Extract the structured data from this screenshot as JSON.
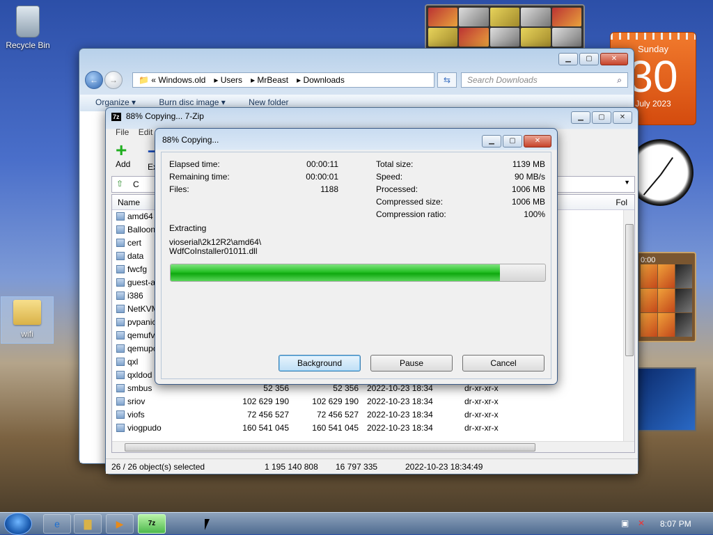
{
  "desktop": {
    "recycle_bin_label": "Recycle Bin",
    "wifi_folder_label": "wifi"
  },
  "gadgets": {
    "calendar_day": "Sunday",
    "calendar_date": "30",
    "calendar_month": "July 2023",
    "puzzle_timer": "0:00"
  },
  "explorer": {
    "breadcrumb_prefix": "«",
    "breadcrumbs": [
      "Windows.old",
      "Users",
      "MrBeast",
      "Downloads"
    ],
    "search_placeholder": "Search Downloads",
    "commands": [
      "Organize ▾",
      "Burn disc image ▾",
      "New folder"
    ]
  },
  "zip": {
    "title": "88% Copying... 7-Zip",
    "logo": "7z",
    "menu": [
      "File",
      "Edit"
    ],
    "toolbar": {
      "add": "Add",
      "extract": "Extr"
    },
    "path_fragment": "C",
    "column_name": "Name",
    "column_folders": "Fol",
    "files": [
      {
        "name": "amd64",
        "size": "",
        "packed": "",
        "modified": "",
        "attr": ""
      },
      {
        "name": "Balloon",
        "size": "",
        "packed": "",
        "modified": "",
        "attr": ""
      },
      {
        "name": "cert",
        "size": "",
        "packed": "",
        "modified": "",
        "attr": ""
      },
      {
        "name": "data",
        "size": "",
        "packed": "",
        "modified": "",
        "attr": ""
      },
      {
        "name": "fwcfg",
        "size": "",
        "packed": "",
        "modified": "",
        "attr": ""
      },
      {
        "name": "guest-a",
        "size": "",
        "packed": "",
        "modified": "",
        "attr": ""
      },
      {
        "name": "i386",
        "size": "",
        "packed": "",
        "modified": "",
        "attr": ""
      },
      {
        "name": "NetKVM",
        "size": "",
        "packed": "",
        "modified": "",
        "attr": ""
      },
      {
        "name": "pvpanic",
        "size": "",
        "packed": "",
        "modified": "",
        "attr": ""
      },
      {
        "name": "qemufv",
        "size": "",
        "packed": "",
        "modified": "",
        "attr": ""
      },
      {
        "name": "qemupc",
        "size": "",
        "packed": "",
        "modified": "",
        "attr": ""
      },
      {
        "name": "qxl",
        "size": "",
        "packed": "",
        "modified": "",
        "attr": ""
      },
      {
        "name": "qxldod",
        "size": "",
        "packed": "",
        "modified": "",
        "attr": ""
      },
      {
        "name": "smbus",
        "size": "52 356",
        "packed": "52 356",
        "modified": "2022-10-23 18:34",
        "attr": "dr-xr-xr-x"
      },
      {
        "name": "sriov",
        "size": "102 629 190",
        "packed": "102 629 190",
        "modified": "2022-10-23 18:34",
        "attr": "dr-xr-xr-x"
      },
      {
        "name": "viofs",
        "size": "72 456 527",
        "packed": "72 456 527",
        "modified": "2022-10-23 18:34",
        "attr": "dr-xr-xr-x"
      },
      {
        "name": "viogpudo",
        "size": "160 541 045",
        "packed": "160 541 045",
        "modified": "2022-10-23 18:34",
        "attr": "dr-xr-xr-x"
      }
    ],
    "status": {
      "selected": "26 / 26 object(s) selected",
      "total_size": "1 195 140 808",
      "packed_size": "16 797 335",
      "modified": "2022-10-23 18:34:49"
    }
  },
  "progress_dialog": {
    "title": "88% Copying...",
    "elapsed_label": "Elapsed time:",
    "elapsed_value": "00:00:11",
    "remaining_label": "Remaining time:",
    "remaining_value": "00:00:01",
    "files_label": "Files:",
    "files_value": "1188",
    "total_size_label": "Total size:",
    "total_size_value": "1139 MB",
    "speed_label": "Speed:",
    "speed_value": "90 MB/s",
    "processed_label": "Processed:",
    "processed_value": "1006 MB",
    "compressed_label": "Compressed size:",
    "compressed_value": "1006 MB",
    "ratio_label": "Compression ratio:",
    "ratio_value": "100%",
    "operation": "Extracting",
    "current_path": "vioserial\\2k12R2\\amd64\\",
    "current_file": "WdfCoInstaller01011.dll",
    "progress_fraction": 0.88,
    "buttons": {
      "background": "Background",
      "pause": "Pause",
      "cancel": "Cancel"
    }
  },
  "taskbar": {
    "clock": "8:07 PM",
    "zip_button_label": "7z"
  }
}
